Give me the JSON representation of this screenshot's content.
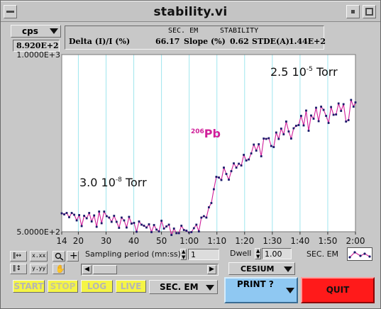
{
  "window": {
    "title": "stability.vi"
  },
  "units_dropdown": {
    "value": "cps"
  },
  "readout": {
    "value": "8.920E+2"
  },
  "stats": {
    "header_left": "SEC. EM",
    "header_right": "STABILITY",
    "delta_label": "Delta (I)/I (%)",
    "delta_value": "66.17",
    "slope_label": "Slope (%)",
    "slope_value": "0.62",
    "stde_label": "STDE(A)",
    "stde_value": "1.44E+2"
  },
  "chart_data": {
    "type": "line",
    "ylim": [
      500,
      1000
    ],
    "ytick_labels": [
      "1.0000E+3",
      "5.0000E+2"
    ],
    "xlim_minutes": [
      0.2333,
      2.0
    ],
    "xtick_labels": [
      "14",
      "20",
      "30",
      "40",
      "50",
      "1:00",
      "1:10",
      "1:20",
      "1:30",
      "1:40",
      "1:50",
      "2:00"
    ],
    "xtick_seconds": [
      14,
      20,
      30,
      40,
      50,
      60,
      70,
      80,
      90,
      100,
      110,
      120
    ],
    "series_color": "#d0209a",
    "point_color": "#1a1a6a",
    "grid_color": "#9fe6ee",
    "annotations": {
      "left_pressure_mantissa": "3.0 10",
      "left_pressure_exp": "-8",
      "left_pressure_unit": " Torr",
      "right_pressure_mantissa": "2.5 10",
      "right_pressure_exp": "-5",
      "right_pressure_unit": " Torr",
      "isotope_mass": "206",
      "isotope_symbol": "Pb"
    },
    "x_seconds": [
      14.0,
      14.9,
      15.8,
      16.7,
      17.6,
      18.5,
      19.4,
      20.3,
      21.2,
      22.1,
      23.0,
      23.9,
      24.8,
      25.7,
      26.6,
      27.5,
      28.4,
      29.3,
      30.2,
      31.1,
      32.0,
      32.9,
      33.8,
      34.7,
      35.6,
      36.5,
      37.4,
      38.3,
      39.2,
      40.1,
      41.0,
      41.9,
      42.8,
      43.7,
      44.6,
      45.5,
      46.4,
      47.3,
      48.2,
      49.1,
      50.0,
      50.9,
      51.8,
      52.7,
      53.6,
      54.5,
      55.4,
      56.3,
      57.2,
      58.1,
      59.0,
      59.9,
      60.8,
      61.7,
      62.6,
      63.5,
      64.4,
      65.3,
      66.2,
      67.1,
      68.0,
      68.9,
      69.8,
      70.7,
      71.6,
      72.5,
      73.4,
      74.3,
      75.2,
      76.1,
      77.0,
      77.9,
      78.8,
      79.7,
      80.6,
      81.5,
      82.4,
      83.3,
      84.2,
      85.1,
      86.0,
      86.9,
      87.8,
      88.7,
      89.6,
      90.5,
      91.4,
      92.3,
      93.2,
      94.1,
      95.0,
      95.9,
      96.8,
      97.7,
      98.6,
      99.5,
      100.4,
      101.3,
      102.2,
      103.1,
      104.0,
      104.9,
      105.8,
      106.7,
      107.6,
      108.5,
      109.4,
      110.3,
      111.2,
      112.1,
      113.0,
      113.9,
      114.8,
      115.7,
      116.6,
      117.5,
      118.4,
      119.3,
      120.0
    ],
    "y_values": [
      552,
      549,
      553,
      541,
      553,
      548,
      532,
      547,
      516,
      545,
      538,
      553,
      529,
      546,
      514,
      557,
      524,
      557,
      544,
      540,
      528,
      545,
      528,
      511,
      540,
      532,
      512,
      542,
      523,
      525,
      500,
      529,
      520,
      517,
      512,
      521,
      499,
      519,
      506,
      501,
      531,
      509,
      515,
      520,
      491,
      509,
      496,
      496,
      517,
      505,
      503,
      498,
      499,
      510,
      520,
      501,
      540,
      544,
      540,
      569,
      581,
      620,
      655,
      653,
      646,
      681,
      663,
      647,
      671,
      693,
      681,
      692,
      687,
      717,
      701,
      704,
      721,
      746,
      729,
      747,
      713,
      763,
      762,
      764,
      742,
      739,
      780,
      762,
      791,
      775,
      811,
      783,
      763,
      792,
      799,
      801,
      827,
      800,
      842,
      785,
      828,
      819,
      850,
      812,
      853,
      844,
      827,
      807,
      852,
      830,
      831,
      862,
      841,
      860,
      811,
      815,
      872,
      853,
      865,
      863,
      843
    ]
  },
  "controls": {
    "sampling_label": "Sampling period (mn:ss)",
    "sampling_value": "1",
    "dwell_label": "Dwell",
    "dwell_value": "1.00",
    "detector_label": "SEC. EM",
    "source_dropdown": "CESIUM",
    "print_label": "PRINT ?",
    "quit_label": "QUIT",
    "start_label": "START",
    "stop_label": "STOP",
    "log_label": "LOG",
    "live_label": "LIVE",
    "detector_dropdown": "SEC. EM",
    "palette_x_label": "x.xx",
    "palette_y_label": "y.yy"
  },
  "colors": {
    "yellow_button": "#f5f545",
    "print_blue": "#8fc8f2",
    "quit_red": "#ff1a1a",
    "plot_bg": "#ffffff",
    "window_bg": "#c8c8c8"
  }
}
